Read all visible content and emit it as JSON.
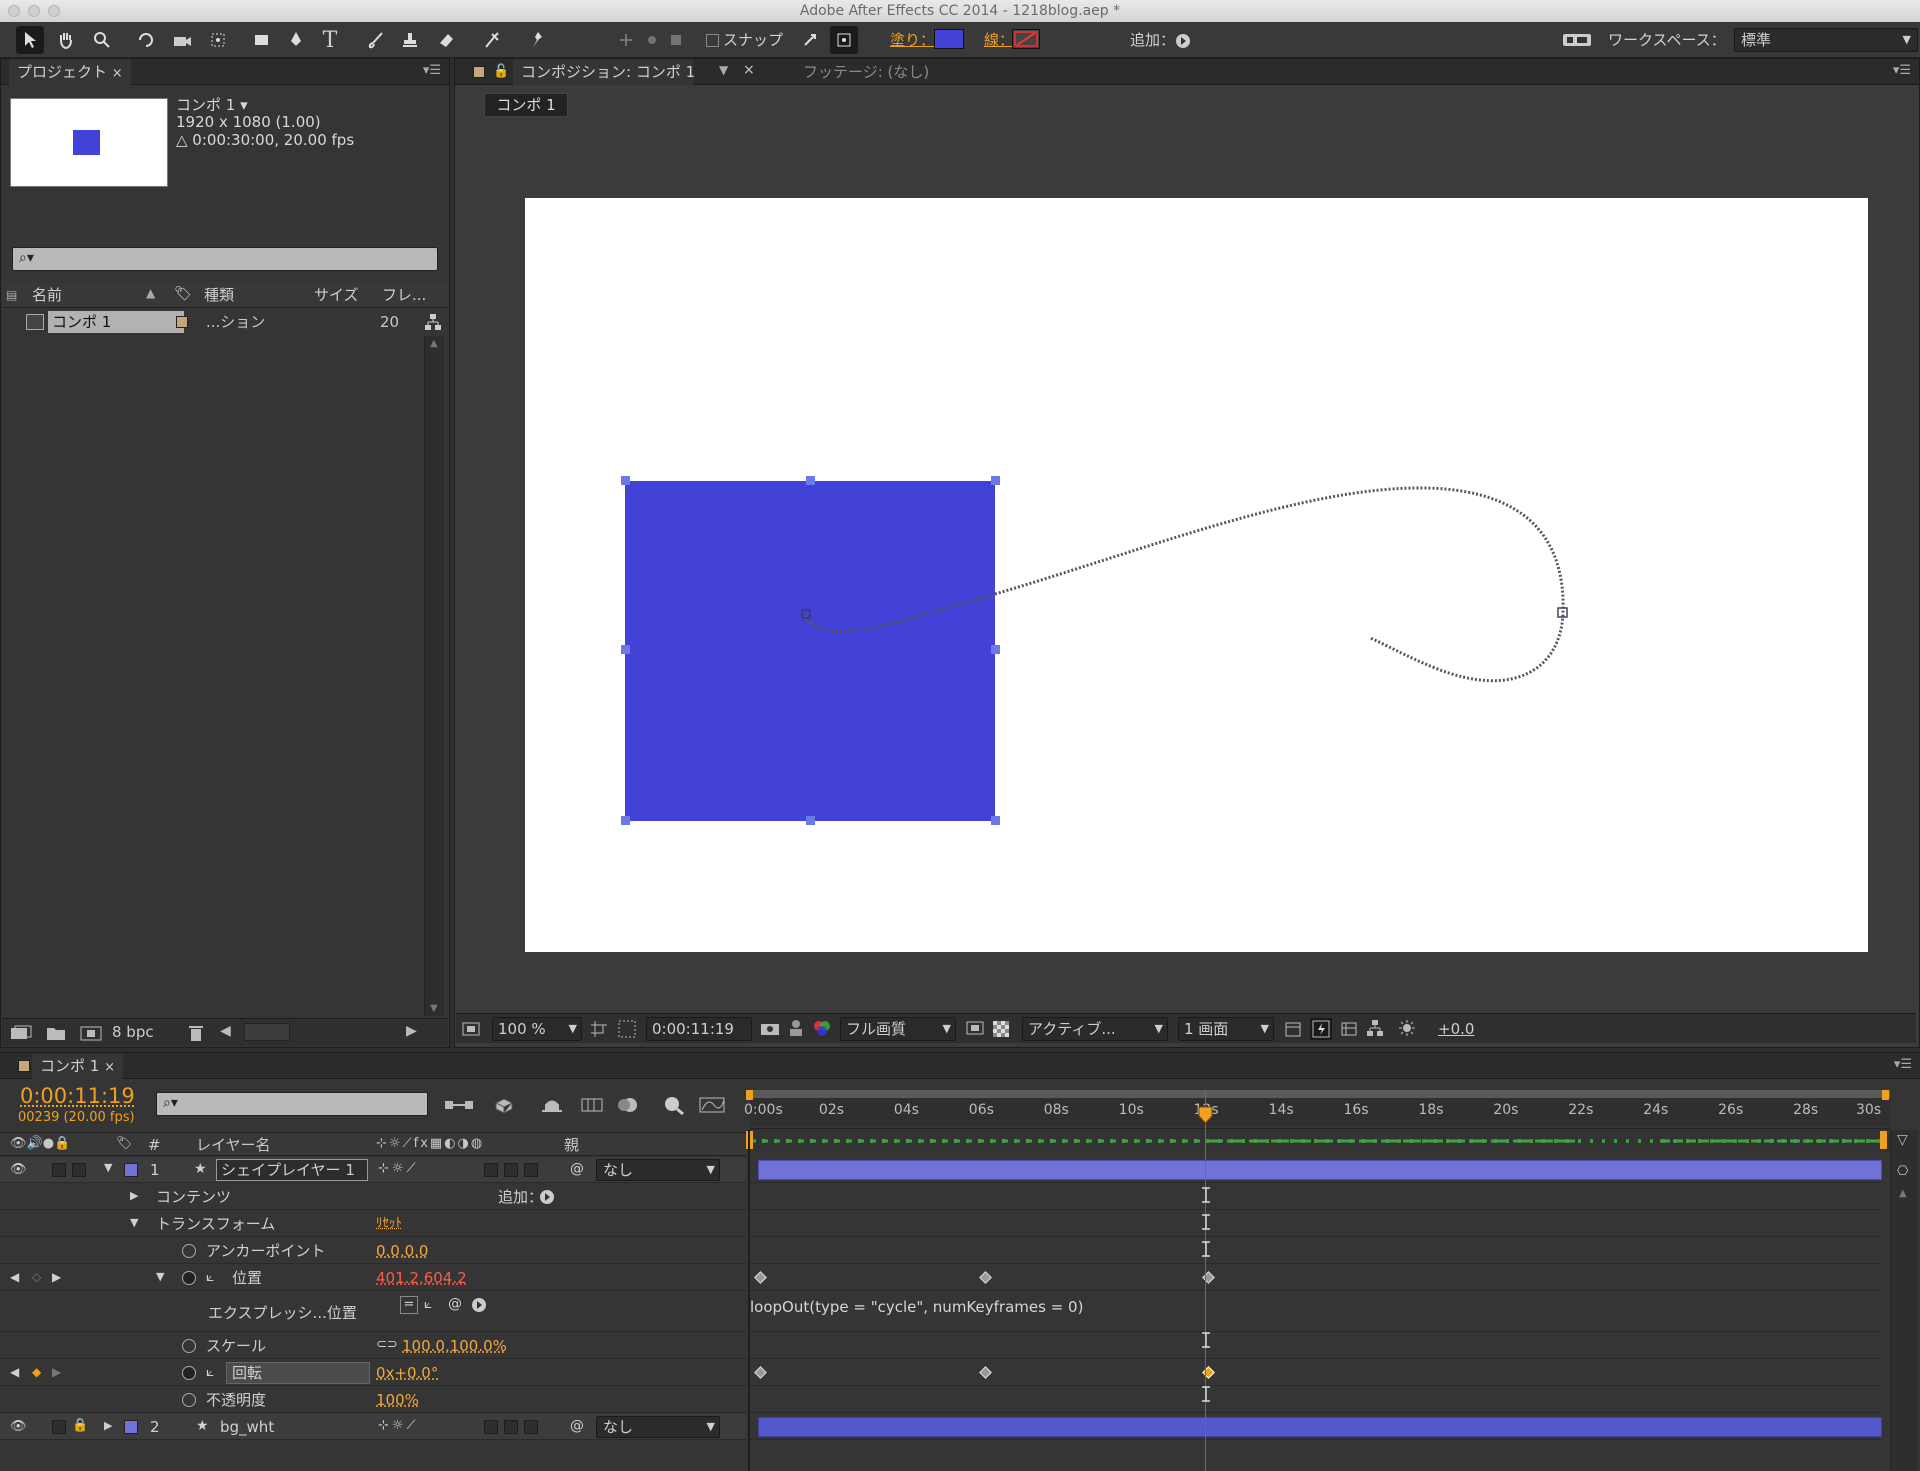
{
  "window": {
    "title": "Adobe After Effects CC 2014 - 1218blog.aep *"
  },
  "toolbar": {
    "snap_label": "スナップ",
    "fill_label": "塗り：",
    "stroke_label": "線：",
    "fill_color": "#4242d8",
    "add_label": "追加：",
    "workspace_label": "ワークスペース：",
    "workspace_value": "標準"
  },
  "project": {
    "tab": "プロジェクト",
    "comp_name": "コンポ 1 ▾",
    "resolution": "1920 x 1080 (1.00)",
    "duration": "△ 0:00:30:00, 20.00 fps",
    "columns": {
      "name": "名前",
      "type": "種類",
      "size": "サイズ",
      "frame": "フレ..."
    },
    "item": {
      "name": "コンポ 1",
      "type": "...ション",
      "frames": "20"
    },
    "bpc": "8 bpc"
  },
  "viewer": {
    "tab_comp": "コンポジション: コンポ 1",
    "tab_footage": "フッテージ: (なし)",
    "comp_button": "コンポ 1",
    "zoom": "100 %",
    "timecode": "0:00:11:19",
    "resolution": "フル画質",
    "camera": "アクティブ...",
    "views": "1 画面",
    "exposure": "+0.0",
    "shape_color": "#4242d8"
  },
  "timeline": {
    "tab": "コンポ 1",
    "current_time": "0:00:11:19",
    "frame_info": "00239 (20.00 fps)",
    "ruler": [
      "0:00s",
      "02s",
      "04s",
      "06s",
      "08s",
      "10s",
      "12s",
      "14s",
      "16s",
      "18s",
      "20s",
      "22s",
      "24s",
      "26s",
      "28s",
      "30s"
    ],
    "header": {
      "hash": "#",
      "layer_name": "レイヤー名",
      "parent": "親"
    },
    "layers": [
      {
        "num": "1",
        "name": "シェイプレイヤー 1",
        "parent": "なし",
        "color": "#6f72d8"
      },
      {
        "num": "2",
        "name": "bg_wht",
        "parent": "なし",
        "color": "#6f72d8"
      }
    ],
    "props": {
      "contents": "コンテンツ",
      "add_label": "追加：",
      "transform": "トランスフォーム",
      "reset": "ﾘｾｯﾄ",
      "anchor": "アンカーポイント",
      "anchor_val": "0.0,0.0",
      "position": "位置",
      "position_val": "401.2,604.2",
      "expression_label": "エクスプレッシ...位置",
      "expression": "loopOut(type = \"cycle\", numKeyframes = 0)",
      "scale": "スケール",
      "scale_val": "100.0,100.0%",
      "rotation": "回転",
      "rotation_val": "0x+0.0°",
      "opacity": "不透明度",
      "opacity_val": "100%"
    }
  }
}
